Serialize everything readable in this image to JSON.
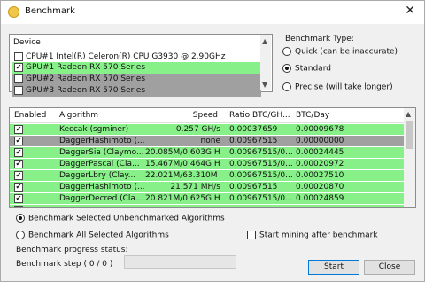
{
  "window": {
    "title": "Benchmark",
    "close_glyph": "✕"
  },
  "devices": {
    "header": "Device",
    "items": [
      {
        "label": "CPU#1 Intel(R) Celeron(R) CPU G3930 @ 2.90GHz",
        "checked": false,
        "bg": "#ffffff"
      },
      {
        "label": "GPU#1 Radeon RX 570 Series",
        "checked": true,
        "bg": "#88f088"
      },
      {
        "label": "GPU#2 Radeon RX 570 Series",
        "checked": false,
        "bg": "#a0a0a0"
      },
      {
        "label": "GPU#3 Radeon RX 570 Series",
        "checked": false,
        "bg": "#a0a0a0"
      }
    ]
  },
  "benchmark_type": {
    "label": "Benchmark Type:",
    "options": [
      {
        "label": "Quick (can be inaccurate)",
        "selected": false
      },
      {
        "label": "Standard",
        "selected": true
      },
      {
        "label": "Precise (will take longer)",
        "selected": false
      }
    ]
  },
  "algorithms": {
    "columns": [
      "Enabled",
      "Algorithm",
      "Speed",
      "Ratio BTC/GH...",
      "BTC/Day"
    ],
    "rows": [
      {
        "enabled": true,
        "algorithm": "Keccak (sgminer)",
        "speed": "0.257 GH/s",
        "ratio": "0.00037659",
        "btc_day": "0.00009678",
        "bg": "#88f088"
      },
      {
        "enabled": true,
        "algorithm": "DaggerHashimoto (...",
        "speed": "none",
        "ratio": "0.00967515",
        "btc_day": "0.00000000",
        "bg": "#a0a0a0"
      },
      {
        "enabled": true,
        "algorithm": "DaggerSia (Claymo...",
        "speed": "20.085M/0.603G H/...",
        "ratio": "0.00967515/0...",
        "btc_day": "0.00024445",
        "bg": "#88f088"
      },
      {
        "enabled": true,
        "algorithm": "DaggerPascal (Cla...",
        "speed": "15.467M/0.464G H/...",
        "ratio": "0.00967515/0...",
        "btc_day": "0.00020972",
        "bg": "#88f088"
      },
      {
        "enabled": true,
        "algorithm": "DaggerLbry (Clay...",
        "speed": "22.021M/63.310M H...",
        "ratio": "0.00967515/0...",
        "btc_day": "0.00027510",
        "bg": "#88f088"
      },
      {
        "enabled": true,
        "algorithm": "DaggerHashimoto (...",
        "speed": "21.571 MH/s",
        "ratio": "0.00967515",
        "btc_day": "0.00020870",
        "bg": "#88f088"
      },
      {
        "enabled": true,
        "algorithm": "DaggerDecred (Cla...",
        "speed": "20.821M/0.625G H/...",
        "ratio": "0.00967515/0...",
        "btc_day": "0.00024859",
        "bg": "#88f088"
      },
      {
        "enabled": true,
        "algorithm": "",
        "speed": "",
        "ratio": "",
        "btc_day": "",
        "bg": "#88f088"
      }
    ]
  },
  "mode": {
    "options": [
      {
        "label": "Benchmark Selected Unbenchmarked Algorithms",
        "selected": true
      },
      {
        "label": "Benchmark All Selected Algorithms",
        "selected": false
      }
    ],
    "start_mining_label": "Start mining after benchmark"
  },
  "status": {
    "progress_label": "Benchmark progress status:",
    "step_label": "Benchmark step ( 0 / 0 )"
  },
  "buttons": {
    "start": "Start",
    "close": "Close"
  },
  "colors": {
    "accent": "#0078d7",
    "ok_row": "#88f088",
    "disabled_row": "#a0a0a0"
  }
}
